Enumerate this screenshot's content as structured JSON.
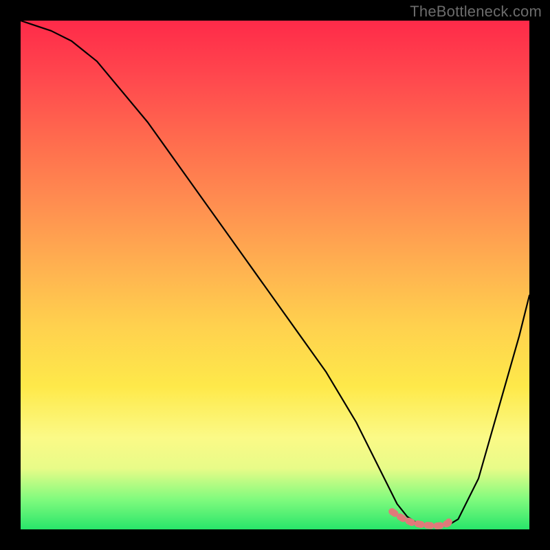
{
  "watermark": {
    "text": "TheBottleneck.com"
  },
  "chart_data": {
    "type": "line",
    "title": "",
    "xlabel": "",
    "ylabel": "",
    "xlim": [
      0,
      100
    ],
    "ylim": [
      0,
      100
    ],
    "series": [
      {
        "name": "bottleneck-curve",
        "x": [
          0,
          3,
          6,
          10,
          15,
          20,
          25,
          30,
          35,
          40,
          45,
          50,
          55,
          60,
          63,
          66,
          69,
          72,
          74,
          76,
          78,
          80,
          82,
          84,
          86,
          90,
          94,
          98,
          100
        ],
        "y": [
          100,
          99,
          98,
          96,
          92,
          86,
          80,
          73,
          66,
          59,
          52,
          45,
          38,
          31,
          26,
          21,
          15,
          9,
          5,
          2.5,
          1.2,
          0.8,
          0.7,
          0.8,
          2,
          10,
          24,
          38,
          46
        ]
      }
    ],
    "highlight_band": {
      "name": "optimal-band",
      "x": [
        73,
        75,
        77,
        79,
        80,
        81,
        82,
        83,
        84,
        84.5
      ],
      "y": [
        3.5,
        2.2,
        1.3,
        0.9,
        0.8,
        0.7,
        0.7,
        0.8,
        1.2,
        2.0
      ]
    },
    "gradient": {
      "top": "#ff2a49",
      "mid": "#ffd14e",
      "bottom": "#28e56a"
    }
  }
}
